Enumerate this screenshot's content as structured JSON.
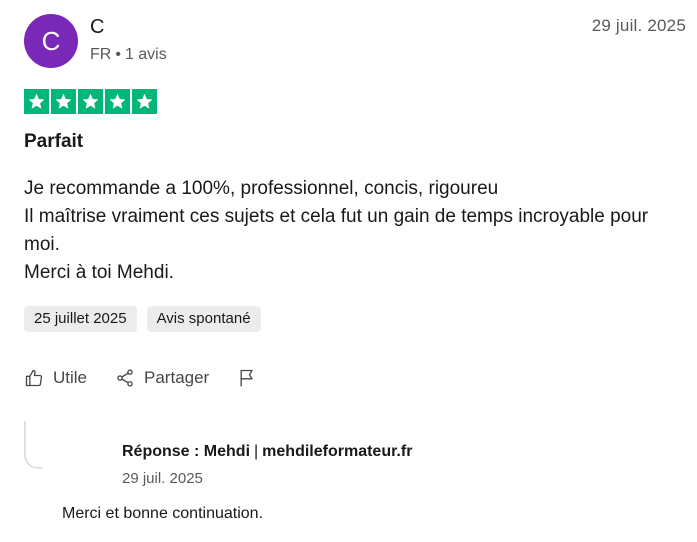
{
  "reviewer": {
    "initial": "C",
    "name": "C",
    "country": "FR",
    "separator": "•",
    "review_count": "1 avis",
    "avatar_color": "#7a28b8"
  },
  "review": {
    "date": "29 juil. 2025",
    "rating": 5,
    "star_color": "#00b67a",
    "title": "Parfait",
    "body_lines": [
      "Je recommande a 100%, professionnel, concis, rigoureu",
      "Il maîtrise vraiment ces sujets et cela fut un gain de temps incroyable pour moi.",
      "Merci à toi Mehdi."
    ],
    "experience_date": "25 juillet 2025",
    "review_type": "Avis spontané"
  },
  "actions": {
    "useful": "Utile",
    "share": "Partager"
  },
  "reply": {
    "label": "Réponse : Mehdi",
    "separator": "|",
    "company": "mehdileformateur.fr",
    "date": "29 juil. 2025",
    "text": "Merci et bonne continuation."
  }
}
